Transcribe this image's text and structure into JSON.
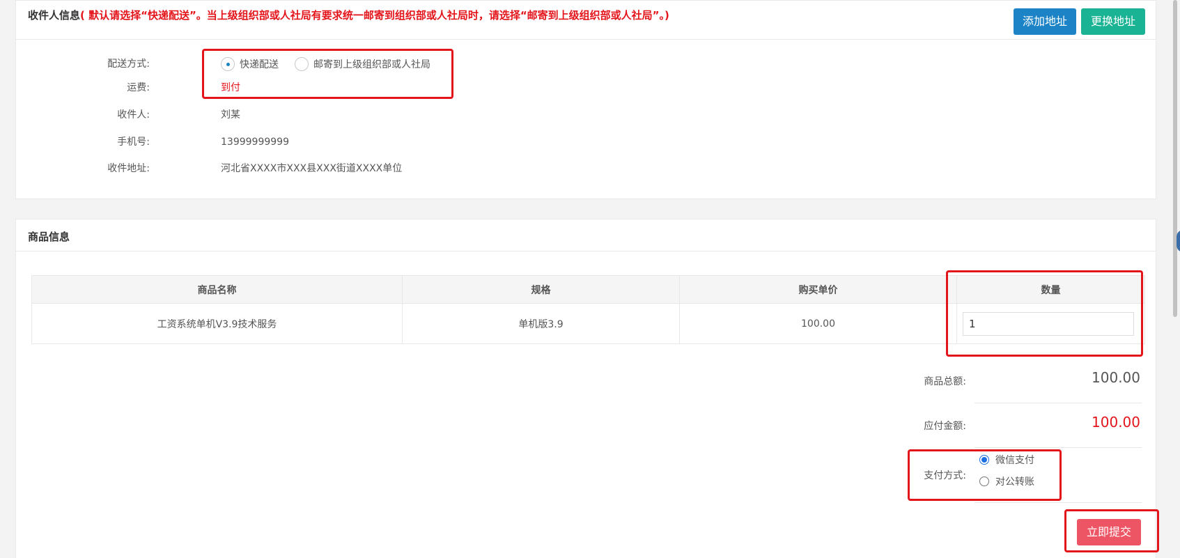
{
  "receiver": {
    "title": "收件人信息",
    "note": "( 默认请选择“快递配送”。当上级组织部或人社局有要求统一邮寄到组织部或人社局时，请选择“邮寄到上级组织部或人社局”。)",
    "add_button": "添加地址",
    "change_button": "更换地址",
    "delivery_label": "配送方式:",
    "delivery_options": [
      "快递配送",
      "邮寄到上级组织部或人社局"
    ],
    "delivery_selected": "快递配送",
    "freight_label": "运费:",
    "freight_value": "到付",
    "name_label": "收件人:",
    "name_value": "刘某",
    "phone_label": "手机号:",
    "phone_value": "13999999999",
    "address_label": "收件地址:",
    "address_value": "河北省XXXX市XXX县XXX街道XXXX单位"
  },
  "goods": {
    "title": "商品信息",
    "columns": [
      "商品名称",
      "规格",
      "购买单价",
      "数量"
    ],
    "rows": [
      {
        "name": "工资系统单机V3.9技术服务",
        "spec": "单机版3.9",
        "price": "100.00",
        "quantity": "1"
      }
    ],
    "subtotal_label": "商品总额:",
    "subtotal_value": "100.00",
    "payable_label": "应付金额:",
    "payable_value": "100.00",
    "payment_label": "支付方式:",
    "payment_options": [
      "微信支付",
      "对公转账"
    ],
    "payment_selected": "微信支付",
    "submit_button": "立即提交"
  },
  "colors": {
    "primary_blue": "#1c84c6",
    "teal": "#1ab394",
    "submit_red": "#ed5565",
    "highlight_red": "#e4141b"
  }
}
